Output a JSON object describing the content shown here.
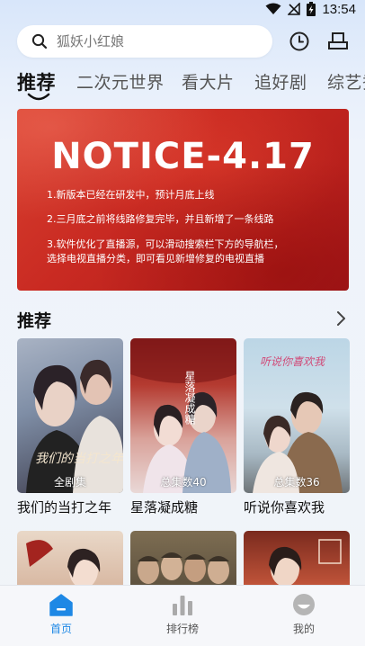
{
  "status_bar": {
    "time": "13:54"
  },
  "search": {
    "placeholder": "狐妖小红娘"
  },
  "tabs": [
    {
      "label": "推荐",
      "active": true
    },
    {
      "label": "二次元世界"
    },
    {
      "label": "看大片"
    },
    {
      "label": "追好剧"
    },
    {
      "label": "综艺秀"
    }
  ],
  "banner": {
    "title": "NOTICE-4.17",
    "lines": [
      "1.新版本已经在研发中，预计月底上线",
      "2.三月底之前将线路修复完毕，并且新增了一条线路",
      "3.软件优化了直播源，可以滑动搜索栏下方的导航栏，",
      "选择电视直播分类，即可看见新增修复的电视直播"
    ]
  },
  "section": {
    "title": "推荐"
  },
  "posters": [
    {
      "title": "我们的当打之年",
      "badge": "全剧集"
    },
    {
      "title": "星落凝成糖",
      "badge": "总集数40"
    },
    {
      "title": "听说你喜欢我",
      "badge": "总集数36"
    }
  ],
  "bottom_nav": [
    {
      "label": "首页",
      "active": true
    },
    {
      "label": "排行榜"
    },
    {
      "label": "我的"
    }
  ],
  "colors": {
    "accent": "#1e88e5",
    "banner_red": "#c92a22"
  }
}
